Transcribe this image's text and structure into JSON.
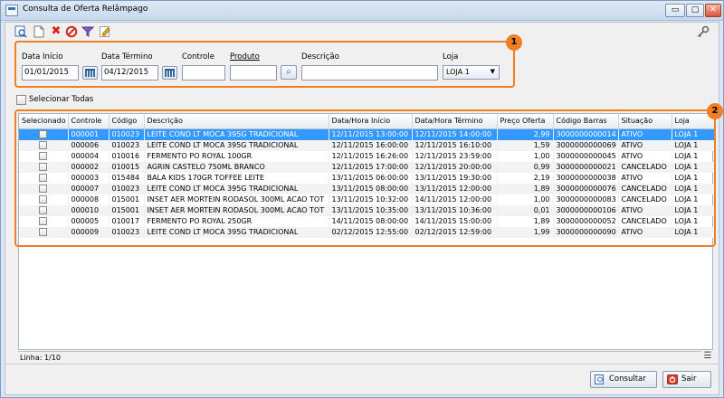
{
  "window": {
    "title": "Consulta de Oferta Relâmpago",
    "min": "▭",
    "max": "▢",
    "close": "✕"
  },
  "toolbar": {
    "icons": [
      "preview-icon",
      "new-document-icon",
      "delete-x-icon",
      "cancel-icon",
      "filter-icon",
      "edit-icon"
    ],
    "key_icon": "key-icon",
    "colors": {
      "delete": "#e0201b",
      "cancel": "#d62b20",
      "filter": "#7a5bbf",
      "edit": "#d6a21b"
    }
  },
  "filters": {
    "data_inicio": {
      "label": "Data Início",
      "value": "01/01/2015"
    },
    "data_termino": {
      "label": "Data Término",
      "value": "04/12/2015"
    },
    "controle": {
      "label": "Controle",
      "value": ""
    },
    "produto": {
      "label": "Produto",
      "value": ""
    },
    "descricao": {
      "label": "Descrição",
      "value": ""
    },
    "loja": {
      "label": "Loja",
      "value": "LOJA 1"
    }
  },
  "badges": {
    "filters": "1",
    "grid": "2"
  },
  "select_all": {
    "label": "Selecionar Todas"
  },
  "grid": {
    "columns": [
      "Selecionado",
      "Controle",
      "Código",
      "Descrição",
      "Data/Hora Início",
      "Data/Hora Término",
      "Preço Oferta",
      "Código Barras",
      "Situação",
      "Loja"
    ],
    "rows": [
      [
        "000001",
        "010023",
        "LEITE COND LT MOCA 395G TRADICIONAL",
        "12/11/2015 13:00:00",
        "12/11/2015 14:00:00",
        "2,99",
        "3000000000014",
        "ATIVO",
        "LOJA 1"
      ],
      [
        "000006",
        "010023",
        "LEITE COND LT MOCA 395G TRADICIONAL",
        "12/11/2015 16:00:00",
        "12/11/2015 16:10:00",
        "1,59",
        "3000000000069",
        "ATIVO",
        "LOJA 1"
      ],
      [
        "000004",
        "010016",
        "FERMENTO PO ROYAL 100GR",
        "12/11/2015 16:26:00",
        "12/11/2015 23:59:00",
        "1,00",
        "3000000000045",
        "ATIVO",
        "LOJA 1"
      ],
      [
        "000002",
        "010015",
        "AGRIN CASTELO 750ML BRANCO",
        "12/11/2015 17:00:00",
        "12/11/2015 20:00:00",
        "0,99",
        "3000000000021",
        "CANCELADO",
        "LOJA 1"
      ],
      [
        "000003",
        "015484",
        "BALA KIDS 170GR TOFFEE LEITE",
        "13/11/2015 06:00:00",
        "13/11/2015 19:30:00",
        "2,19",
        "3000000000038",
        "ATIVO",
        "LOJA 1"
      ],
      [
        "000007",
        "010023",
        "LEITE COND LT MOCA 395G TRADICIONAL",
        "13/11/2015 08:00:00",
        "13/11/2015 12:00:00",
        "1,89",
        "3000000000076",
        "CANCELADO",
        "LOJA 1"
      ],
      [
        "000008",
        "015001",
        "INSET AER MORTEIN RODASOL 300ML ACAO TOT",
        "13/11/2015 10:32:00",
        "14/11/2015 12:00:00",
        "1,00",
        "3000000000083",
        "CANCELADO",
        "LOJA 1"
      ],
      [
        "000010",
        "015001",
        "INSET AER MORTEIN RODASOL 300ML ACAO TOT",
        "13/11/2015 10:35:00",
        "13/11/2015 10:36:00",
        "0,01",
        "3000000000106",
        "ATIVO",
        "LOJA 1"
      ],
      [
        "000005",
        "010017",
        "FERMENTO PO ROYAL 250GR",
        "14/11/2015 08:00:00",
        "14/11/2015 15:00:00",
        "1,89",
        "3000000000052",
        "CANCELADO",
        "LOJA 1"
      ],
      [
        "000009",
        "010023",
        "LEITE COND LT MOCA 395G TRADICIONAL",
        "02/12/2015 12:55:00",
        "02/12/2015 12:59:00",
        "1,99",
        "3000000000090",
        "ATIVO",
        "LOJA 1"
      ]
    ],
    "selected_row": 0,
    "selection_color": "#3399ff"
  },
  "status": {
    "text": "Linha: 1/10"
  },
  "buttons": {
    "consultar": "Consultar",
    "sair": "Sair"
  },
  "accent": "#ef7f22"
}
